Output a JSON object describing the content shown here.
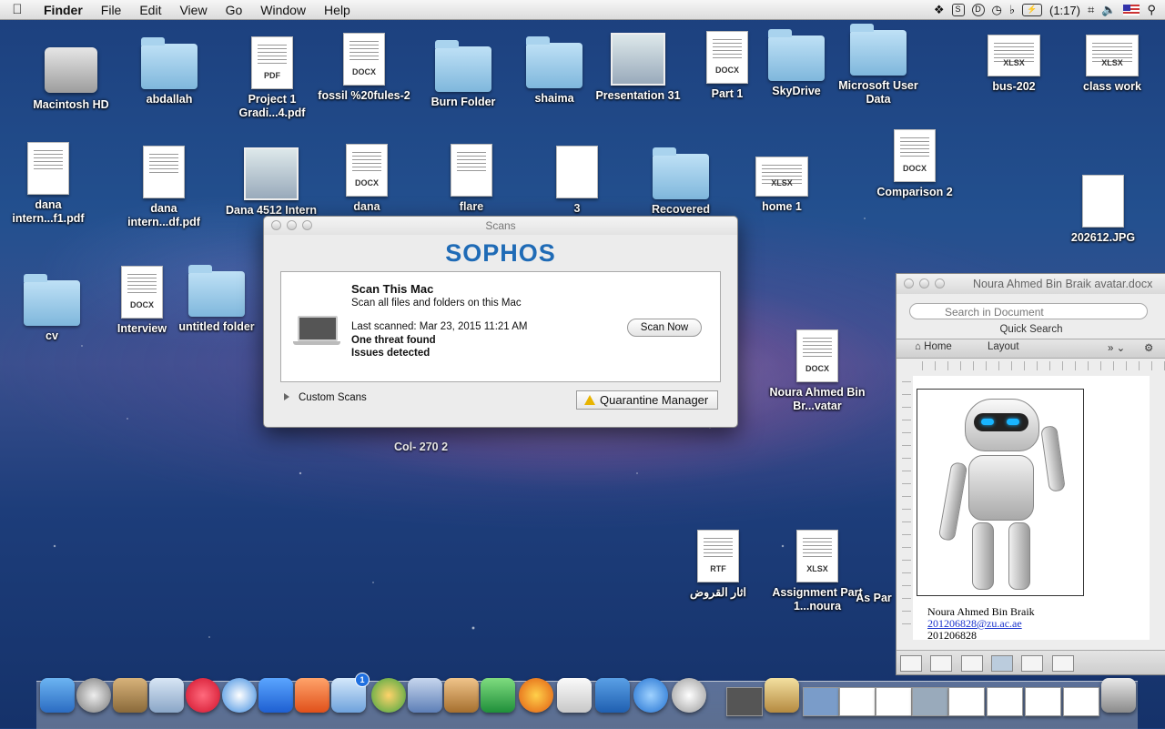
{
  "menubar": {
    "apple": "",
    "app": "Finder",
    "items": [
      "File",
      "Edit",
      "View",
      "Go",
      "Window",
      "Help"
    ],
    "battery": "(1:17)",
    "flag": "US"
  },
  "desktop": {
    "icons": [
      {
        "label": "Macintosh HD",
        "kind": "drive"
      },
      {
        "label": "abdallah",
        "kind": "folder"
      },
      {
        "label": "Project 1 Gradi...4.pdf",
        "kind": "doc",
        "tag": "PDF"
      },
      {
        "label": "fossil %20fules-2",
        "kind": "doc",
        "tag": "DOCX"
      },
      {
        "label": "Burn Folder",
        "kind": "folder"
      },
      {
        "label": "shaima",
        "kind": "folder"
      },
      {
        "label": "Presentation 31",
        "kind": "thumb"
      },
      {
        "label": "Part 1",
        "kind": "doc",
        "tag": "DOCX"
      },
      {
        "label": "SkyDrive",
        "kind": "folder"
      },
      {
        "label": "Microsoft User Data",
        "kind": "folder"
      },
      {
        "label": "bus-202",
        "kind": "doc",
        "tag": "XLSX"
      },
      {
        "label": "class work",
        "kind": "doc",
        "tag": "XLSX"
      },
      {
        "label": "dana intern...f1.pdf",
        "kind": "doc",
        "tag": ""
      },
      {
        "label": "dana intern...df.pdf",
        "kind": "doc",
        "tag": ""
      },
      {
        "label": "Dana 4512 Intern",
        "kind": "thumb"
      },
      {
        "label": "dana",
        "kind": "doc",
        "tag": "DOCX"
      },
      {
        "label": "flare",
        "kind": "doc",
        "tag": ""
      },
      {
        "label": "3",
        "kind": "doc",
        "tag": ""
      },
      {
        "label": "Recovered",
        "kind": "folder"
      },
      {
        "label": "home 1",
        "kind": "doc",
        "tag": "XLSX"
      },
      {
        "label": "Comparison 2",
        "kind": "doc",
        "tag": "DOCX"
      },
      {
        "label": "202612.JPG",
        "kind": "doc",
        "tag": ""
      },
      {
        "label": "cv",
        "kind": "folder"
      },
      {
        "label": "Interview",
        "kind": "doc",
        "tag": "DOCX"
      },
      {
        "label": "untitled folder",
        "kind": "folder"
      },
      {
        "label": "Noura Ahmed Bin Br...vatar",
        "kind": "doc",
        "tag": "DOCX"
      },
      {
        "label": "اثار القروض",
        "kind": "doc",
        "tag": "RTF"
      },
      {
        "label": "Assignment Part 1...noura",
        "kind": "doc",
        "tag": "XLSX"
      },
      {
        "label": "As Par",
        "kind": "doc",
        "tag": ""
      }
    ],
    "col_label": "Col- 270 2"
  },
  "scans": {
    "title": "Scans",
    "logo": "SOPHOS",
    "scan_title": "Scan This Mac",
    "scan_sub": "Scan all files and folders on this Mac",
    "last_scanned": "Last scanned: Mar 23, 2015 11:21 AM",
    "threat": "One threat found",
    "issues": "Issues detected",
    "scan_now": "Scan Now",
    "custom_scans": "Custom Scans",
    "quarantine": "Quarantine Manager"
  },
  "doc": {
    "title": "Noura Ahmed Bin Braik avatar.docx",
    "search_placeholder": "Search in Document",
    "quick_search": "Quick Search",
    "tabs": [
      "Home",
      "Layout"
    ],
    "name": "Noura Ahmed Bin Braik",
    "email": "201206828@zu.ac.ae",
    "id": "201206828"
  },
  "dock": {
    "badge": "1"
  }
}
